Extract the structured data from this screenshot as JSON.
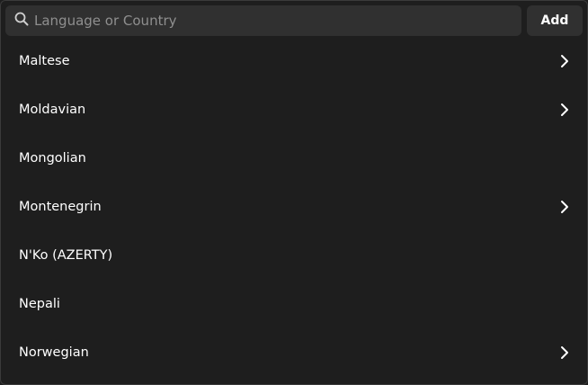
{
  "search": {
    "placeholder": "Language or Country",
    "value": "",
    "icon": "search-icon"
  },
  "add_button": {
    "label": "Add"
  },
  "list": {
    "items": [
      {
        "label": "Maltese",
        "has_submenu": true
      },
      {
        "label": "Moldavian",
        "has_submenu": true
      },
      {
        "label": "Mongolian",
        "has_submenu": false
      },
      {
        "label": "Montenegrin",
        "has_submenu": true
      },
      {
        "label": "N'Ko (AZERTY)",
        "has_submenu": false
      },
      {
        "label": "Nepali",
        "has_submenu": false
      },
      {
        "label": "Norwegian",
        "has_submenu": true
      }
    ]
  },
  "colors": {
    "background": "#1e1e1e",
    "control": "#303030",
    "text": "#ffffff",
    "placeholder": "#8f8f8f"
  }
}
